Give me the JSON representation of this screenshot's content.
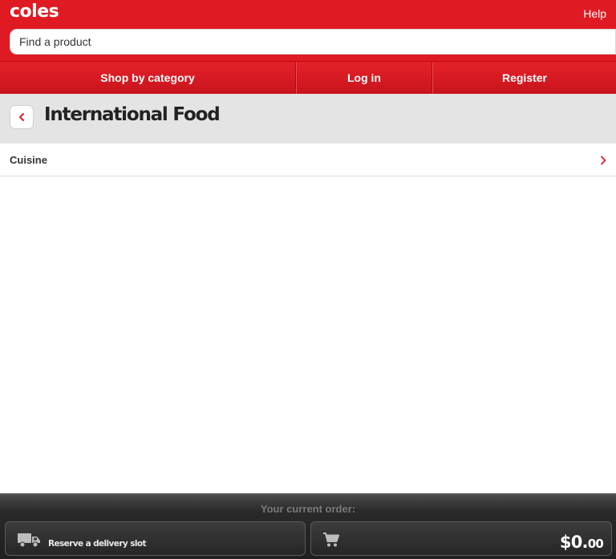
{
  "header": {
    "logo_text": "coles",
    "help_label": "Help",
    "search": {
      "placeholder": "Find a product",
      "value": ""
    }
  },
  "nav": {
    "shop_by_category": "Shop by category",
    "log_in": "Log in",
    "register": "Register"
  },
  "page": {
    "title": "International Food",
    "back_icon": "chevron-left-icon"
  },
  "categories": [
    {
      "label": "Cuisine",
      "icon": "chevron-right-icon"
    }
  ],
  "footer": {
    "title": "Your current order:",
    "delivery_label": "Reserve a delivery slot",
    "delivery_icon": "truck-icon",
    "cart_icon": "shopping-cart-icon",
    "cart_dollars": "$0.",
    "cart_cents": "00"
  },
  "colors": {
    "brand_red": "#e01a22",
    "footer_dark": "#1f1f1f"
  }
}
